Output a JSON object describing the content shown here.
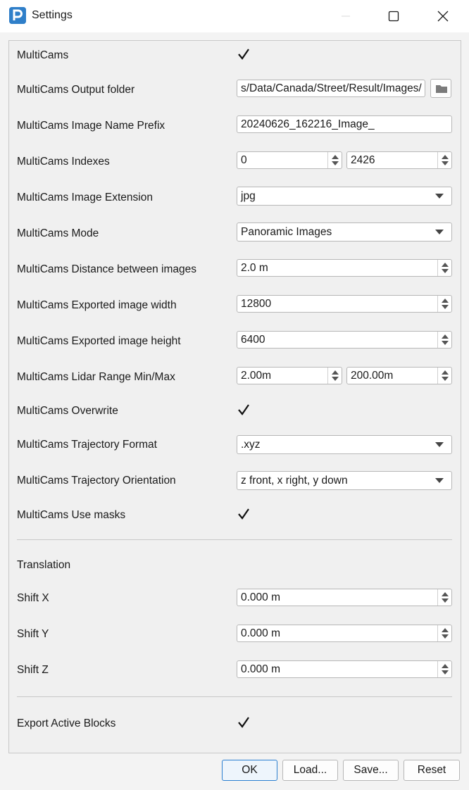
{
  "window": {
    "title": "Settings",
    "icon": "app-logo-icon"
  },
  "multicams": {
    "enabled": {
      "label": "MultiCams",
      "checked": true
    },
    "output_folder": {
      "label": "MultiCams Output folder",
      "value": "s/Data/Canada/Street/Result/Images/"
    },
    "name_prefix": {
      "label": "MultiCams Image Name Prefix",
      "value": "20240626_162216_Image_"
    },
    "indexes": {
      "label": "MultiCams Indexes",
      "from": "0",
      "to": "2426"
    },
    "extension": {
      "label": "MultiCams Image Extension",
      "value": "jpg"
    },
    "mode": {
      "label": "MultiCams Mode",
      "value": "Panoramic Images"
    },
    "distance": {
      "label": "MultiCams Distance between images",
      "value": "2.0 m"
    },
    "width": {
      "label": "MultiCams Exported image width",
      "value": "12800"
    },
    "height": {
      "label": "MultiCams Exported image height",
      "value": "6400"
    },
    "lidar_range": {
      "label": "MultiCams Lidar Range Min/Max",
      "min": "2.00m",
      "max": "200.00m"
    },
    "overwrite": {
      "label": "MultiCams Overwrite",
      "checked": true
    },
    "trajectory_format": {
      "label": "MultiCams Trajectory Format",
      "value": ".xyz"
    },
    "trajectory_orientation": {
      "label": "MultiCams Trajectory Orientation",
      "value": "z front, x right, y down"
    },
    "use_masks": {
      "label": "MultiCams Use masks",
      "checked": true
    }
  },
  "translation": {
    "heading": "Translation",
    "shift_x": {
      "label": "Shift X",
      "value": "0.000 m"
    },
    "shift_y": {
      "label": "Shift Y",
      "value": "0.000 m"
    },
    "shift_z": {
      "label": "Shift Z",
      "value": "0.000 m"
    }
  },
  "export_active_blocks": {
    "label": "Export Active Blocks",
    "checked": true
  },
  "buttons": {
    "ok": "OK",
    "load": "Load...",
    "save": "Save...",
    "reset": "Reset"
  },
  "colors": {
    "accent": "#1ea3d6",
    "focus_border": "#2b7fd0",
    "background": "#f0f0f0"
  }
}
